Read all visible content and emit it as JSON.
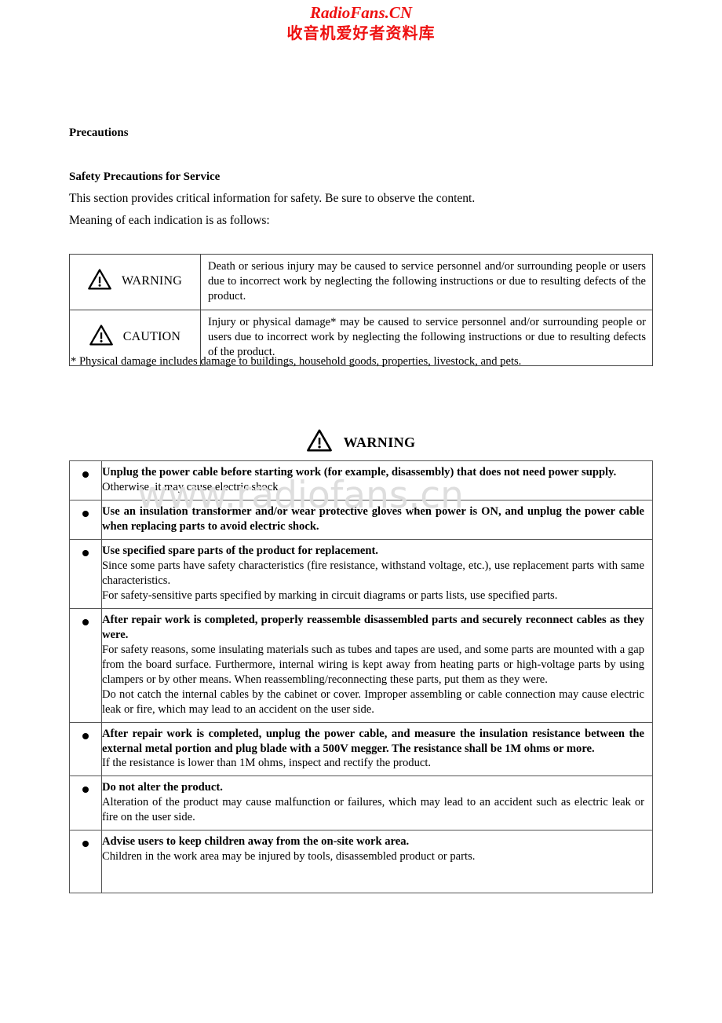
{
  "site_watermark": {
    "brand_en": "RadioFans.CN",
    "brand_cn": "收音机爱好者资料库",
    "brand_color": "#ee1111",
    "body_watermark": "www.radiofans.cn",
    "body_watermark_color": "#dedede"
  },
  "headings": {
    "precautions": "Precautions",
    "safety": "Safety Precautions for Service"
  },
  "intro": {
    "line1": "This section provides critical information for safety. Be sure to observe the content.",
    "line2": "Meaning of each indication is as follows:"
  },
  "definitions": {
    "rows": [
      {
        "icon": "warning-triangle-icon",
        "label": "WARNING",
        "description": "Death or serious injury may be caused to service personnel and/or surrounding people or users due to incorrect work by neglecting the following instructions or due to resulting defects of the product."
      },
      {
        "icon": "warning-triangle-icon",
        "label": "CAUTION",
        "description": "Injury or physical damage* may be caused to service personnel and/or surrounding people or users due to incorrect work by neglecting the following instructions or due to resulting defects of the product."
      }
    ]
  },
  "footnote": "* Physical damage includes damage to buildings, household goods, properties, livestock, and pets.",
  "warning_banner": {
    "icon": "warning-triangle-icon",
    "label": "WARNING"
  },
  "warning_items": [
    {
      "bullet": "bullet-dot",
      "heading": "Unplug the power cable before starting work (for example, disassembly) that does not need power supply.",
      "body": [
        "Otherwise, it may cause electric shock."
      ]
    },
    {
      "bullet": "bullet-dot",
      "heading": "Use an insulation transformer and/or wear protective gloves when power is ON, and unplug the power cable when replacing parts to avoid electric shock.",
      "body": []
    },
    {
      "bullet": "bullet-dot",
      "heading": "Use specified spare parts of the product for replacement.",
      "body": [
        "Since some parts have safety characteristics (fire resistance, withstand voltage, etc.), use replacement parts with same characteristics.",
        "For safety-sensitive parts specified by marking in circuit diagrams or parts lists, use specified parts."
      ]
    },
    {
      "bullet": "bullet-dot",
      "heading": "After repair work is completed, properly reassemble disassembled parts and securely reconnect cables as they were.",
      "body": [
        "For safety reasons, some insulating materials such as tubes and tapes are used, and some parts are mounted with a gap from the board surface. Furthermore, internal wiring is kept away from heating parts or high-voltage parts by using clampers or by other means. When reassembling/reconnecting these parts, put them as they were.",
        "Do not catch the internal cables by the cabinet or cover. Improper assembling or cable connection may cause electric leak or fire, which may lead to an accident on the user side."
      ]
    },
    {
      "bullet": "bullet-dot",
      "heading": "After repair work is completed, unplug the power cable, and measure the insulation resistance between the external metal portion and plug blade with a 500V megger. The resistance shall be 1M ohms or more.",
      "body": [
        "If the resistance is lower than 1M ohms, inspect and rectify the product."
      ]
    },
    {
      "bullet": "bullet-dot",
      "heading": "Do not alter the product.",
      "body": [
        "Alteration of the product may cause malfunction or failures, which may lead to an accident such as electric leak or fire on the user side."
      ]
    },
    {
      "bullet": "bullet-dot",
      "heading": "Advise users to keep children away from the on-site work area.",
      "body": [
        "Children in the work area may be injured by tools, disassembled product or parts."
      ]
    }
  ]
}
